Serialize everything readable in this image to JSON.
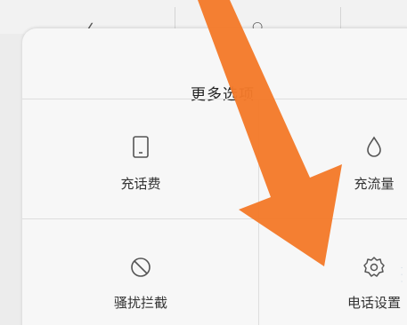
{
  "sheet": {
    "title": "更多选项"
  },
  "options": [
    {
      "label": "充话费",
      "icon": "phone-recharge-icon"
    },
    {
      "label": "充流量",
      "icon": "data-drop-icon"
    },
    {
      "label": "骚扰拦截",
      "icon": "block-icon"
    },
    {
      "label": "电话设置",
      "icon": "gear-icon"
    }
  ],
  "colors": {
    "arrow": "#f47a2a",
    "sheet_bg": "#f7f7f7",
    "divider": "#dedede",
    "text": "#333333"
  }
}
